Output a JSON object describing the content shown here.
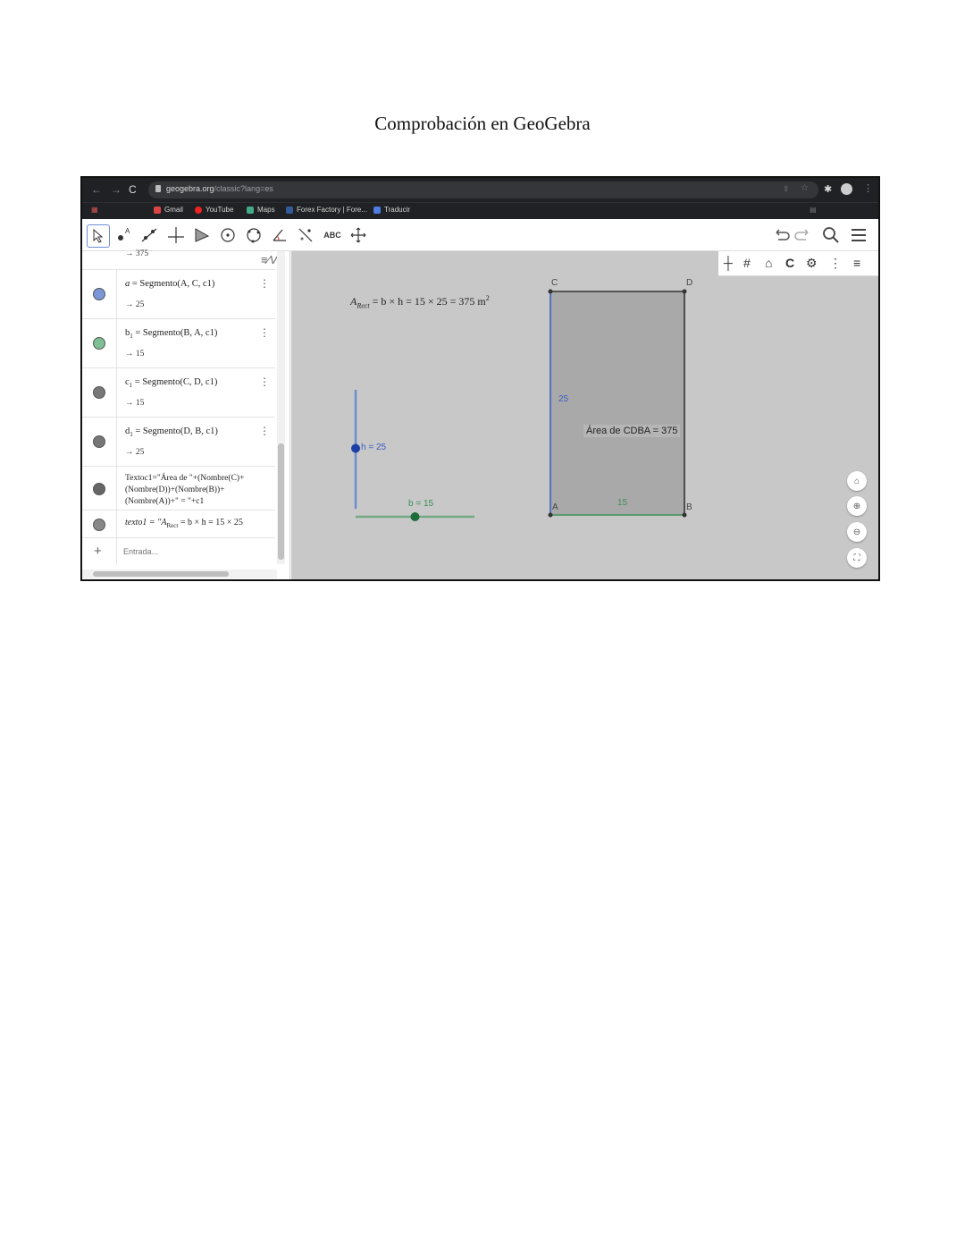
{
  "document": {
    "title": "Comprobación en GeoGebra"
  },
  "browser": {
    "url_host": "geogebra.org",
    "url_path": "/classic?lang=es",
    "bookmarks": [
      "Gmail",
      "YouTube",
      "Maps",
      "Forex Factory | Fore...",
      "Traducir"
    ]
  },
  "toolbar": {
    "text_tool_label": "ABC"
  },
  "algebra": {
    "top_value": "→ 375",
    "rows": [
      {
        "name": "a",
        "sub": "",
        "def": "Segmento(A, C, c1)",
        "value": "→ 25",
        "color": "#7b97d8"
      },
      {
        "name": "b",
        "sub": "1",
        "def": "Segmento(B, A, c1)",
        "value": "→ 15",
        "color": "#7fbf94"
      },
      {
        "name": "c",
        "sub": "1",
        "def": "Segmento(C, D, c1)",
        "value": "→ 15",
        "color": "#777777"
      },
      {
        "name": "d",
        "sub": "1",
        "def": "Segmento(D, B, c1)",
        "value": "→ 25",
        "color": "#777777"
      }
    ],
    "texto1_lines": [
      "Textoc1=\"Área de \"+(Nombre(C)+",
      "(Nombre(D))+(Nombre(B))+",
      "(Nombre(A))+\" = \"+c1"
    ],
    "texto1_formula_prefix": "texto1 = \"",
    "texto1_formula_rest": " = b × h = 15 × 25",
    "input_placeholder": "Entrada..."
  },
  "graphics": {
    "formula_lhs": "A",
    "formula_sub": "Rect",
    "formula_rest": " = b × h = 15 × 25 = 375 m",
    "formula_sup": "2",
    "area_label": "Área de  CDBA = 375",
    "slider_h_label": "h = 25",
    "slider_b_label": "b = 15",
    "side_left_label": "25",
    "side_bottom_label": "15",
    "points": {
      "A": "A",
      "B": "B",
      "C": "C",
      "D": "D"
    },
    "slider_h_value": 25,
    "slider_b_value": 15,
    "colors": {
      "segment_a": "#3b5fc4",
      "segment_b": "#3a8f57",
      "rect_fill": "#a9a9a9",
      "slider_h": "#1c3fa8",
      "slider_b": "#1e6b3b"
    }
  }
}
